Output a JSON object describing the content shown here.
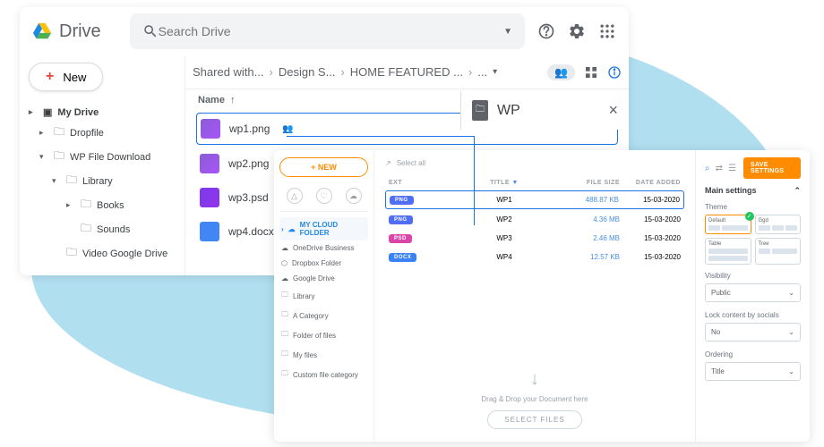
{
  "gdrive": {
    "brand": "Drive",
    "search_placeholder": "Search Drive",
    "new_button": "New",
    "tree": {
      "root": "My Drive",
      "items": [
        "Dropfile",
        "WP File Download",
        "Library",
        "Books",
        "Sounds",
        "Video Google Drive"
      ]
    },
    "breadcrumbs": [
      "Shared with...",
      "Design S...",
      "HOME FEATURED ...",
      "..."
    ],
    "list_header": "Name",
    "files": [
      {
        "name": "wp1.png",
        "thumb": "purple"
      },
      {
        "name": "wp2.png",
        "thumb": "purple"
      },
      {
        "name": "wp3.psd",
        "thumb": "purple2"
      },
      {
        "name": "wp4.docx",
        "thumb": "blue"
      }
    ],
    "detail_title": "WP"
  },
  "wp": {
    "new_button": "+ NEW",
    "select_all": "Select all",
    "folders": [
      {
        "label": "MY CLOUD FOLDER",
        "active": true,
        "icon": "cloud"
      },
      {
        "label": "OneDrive Business",
        "icon": "cloud"
      },
      {
        "label": "Dropbox Folder",
        "icon": "dropbox"
      },
      {
        "label": "Google Drive",
        "icon": "cloud"
      },
      {
        "label": "Library",
        "icon": "folder"
      },
      {
        "label": "A Category",
        "icon": "folder"
      },
      {
        "label": "Folder of files",
        "icon": "folder"
      },
      {
        "label": "My files",
        "icon": "folder"
      },
      {
        "label": "Custom file category",
        "icon": "folder"
      }
    ],
    "columns": {
      "ext": "EXT",
      "title": "TITLE",
      "size": "FILE SIZE",
      "date": "DATE ADDED"
    },
    "rows": [
      {
        "ext": "PNG",
        "extClass": "png",
        "title": "WP1",
        "size": "488.87 KB",
        "date": "15-03-2020",
        "selected": true
      },
      {
        "ext": "PNG",
        "extClass": "png",
        "title": "WP2",
        "size": "4.36 MB",
        "date": "15-03-2020"
      },
      {
        "ext": "PSD",
        "extClass": "psd",
        "title": "WP3",
        "size": "2.46 MB",
        "date": "15-03-2020"
      },
      {
        "ext": "DOCX",
        "extClass": "docx",
        "title": "WP4",
        "size": "12.57 KB",
        "date": "15-03-2020"
      }
    ],
    "drop_text": "Drag & Drop your Document here",
    "select_files": "SELECT FILES",
    "save": "SAVE SETTINGS",
    "settings_head": "Main settings",
    "theme_label": "Theme",
    "themes": [
      "Default",
      "Ggd",
      "Table",
      "Tree"
    ],
    "visibility_label": "Visibility",
    "visibility": "Public",
    "lock_label": "Lock content by socials",
    "lock": "No",
    "ordering_label": "Ordering",
    "ordering": "Title"
  }
}
